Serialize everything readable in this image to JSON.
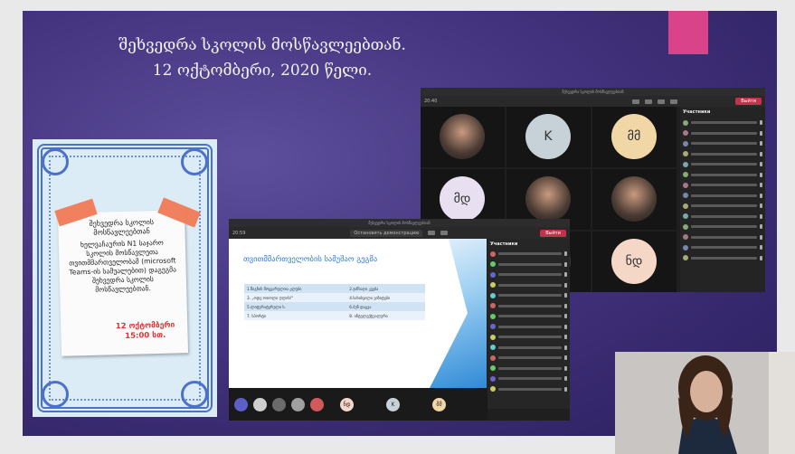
{
  "slide": {
    "title_line1": "შეხვედრა სკოლის მოსწავლეებთან.",
    "title_line2": "12 ოქტომბერი, 2020 წელი.",
    "accent_color": "#d8438a",
    "bg_color": "#44337f"
  },
  "poster": {
    "heading": "შეხვედრა სკოლის მოსწავლეებთან",
    "body": "ხელვაჩაურის N1 საჯარო სკოლის მოსწავლეთა თვითმმართველობამ (microsoft Teams-ის სამუალებით) დაგეგმა შეხვედრა სკოლის მოსწავლეებთან.",
    "date": "12 ოქტომბერი",
    "time": "15:00 სთ."
  },
  "teams_back": {
    "window_title": "შეხვედრა სკოლის მოსწავლეებთან",
    "timer": "20:40",
    "leave_label": "Выйти",
    "people_header": "Участники",
    "tiles": [
      {
        "initials": "",
        "kind": "photo"
      },
      {
        "initials": "K",
        "kind": "avatar",
        "color": "#c7d2d8"
      },
      {
        "initials": "მმ",
        "kind": "avatar",
        "color": "#f2d7a6"
      },
      {
        "initials": "მდ",
        "kind": "avatar",
        "color": "#e8e0f0"
      },
      {
        "initials": "",
        "kind": "photo"
      },
      {
        "initials": "",
        "kind": "photo"
      },
      {
        "initials": "",
        "kind": "photo"
      },
      {
        "initials": "",
        "kind": "photo"
      },
      {
        "initials": "ნდ",
        "kind": "avatar",
        "color": "#f5d7c7"
      }
    ]
  },
  "teams_front": {
    "window_title": "შეხვედრა სკოლის მოსწავლეებთან",
    "timer": "20:59",
    "stop_share_label": "Остановить демонстрацию",
    "leave_label": "Выйти",
    "people_header": "Участники",
    "slide_title": "თვითმმართველობის სამუშაო გეგმა",
    "table": [
      [
        "1.წიგნის მოყვარულთა კლუბი",
        "2.ჯანსაღი კვება"
      ],
      [
        "3. „ოდე ოთოლი ღლის!\"",
        "4.სახისვილი ვიზიტები"
      ],
      [
        "5.ლიტერატურული ს.",
        "6.ბუნ დაცვა"
      ],
      [
        "7. სპორტი",
        "8. ინტელექტუალური"
      ]
    ],
    "bottom_avatars": [
      "ნდ",
      "K",
      "მმ"
    ]
  }
}
